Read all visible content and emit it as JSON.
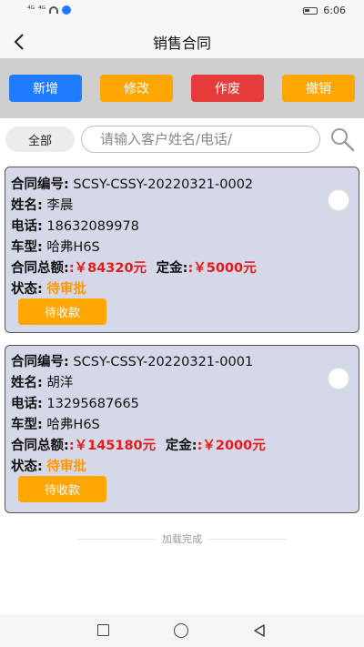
{
  "status_bar": {
    "signal1": "⁴ᴳ",
    "signal2": "⁴ᴳ",
    "time": "6:06"
  },
  "header": {
    "back_icon": "chevron-left-icon",
    "title": "销售合同"
  },
  "actions": {
    "add": "新增",
    "edit": "修改",
    "void": "作废",
    "revoke": "撤销"
  },
  "filter": {
    "chip": "全部",
    "search_placeholder": "请输入客户姓名/电话/"
  },
  "contracts": [
    {
      "no_label": "合同编号:",
      "no": "SCSY-CSSY-20220321-0002",
      "name_label": "姓名:",
      "name": "李晨",
      "phone_label": "电话:",
      "phone": "18632089978",
      "model_label": "车型:",
      "model": "哈弗H6S",
      "total_label": "合同总额:",
      "total": ":￥84320元",
      "deposit_label": "定金:",
      "deposit": ":￥5000元",
      "status_label": "状态:",
      "status": "待审批",
      "pay_button": "待收款"
    },
    {
      "no_label": "合同编号:",
      "no": "SCSY-CSSY-20220321-0001",
      "name_label": "姓名:",
      "name": "胡洋",
      "phone_label": "电话:",
      "phone": "13295687665",
      "model_label": "车型:",
      "model": "哈弗H6S",
      "total_label": "合同总额:",
      "total": ":￥145180元",
      "deposit_label": "定金:",
      "deposit": ":￥2000元",
      "status_label": "状态:",
      "status": "待审批",
      "pay_button": "待收款"
    }
  ],
  "footer": {
    "loaded_text": "加载完成"
  },
  "colors": {
    "primary": "#1f7bff",
    "warning": "#ffa600",
    "danger": "#e53b3b",
    "amount_red": "#e51c1c",
    "status_orange": "#ff9800",
    "card_bg": "#d4d8e8"
  }
}
